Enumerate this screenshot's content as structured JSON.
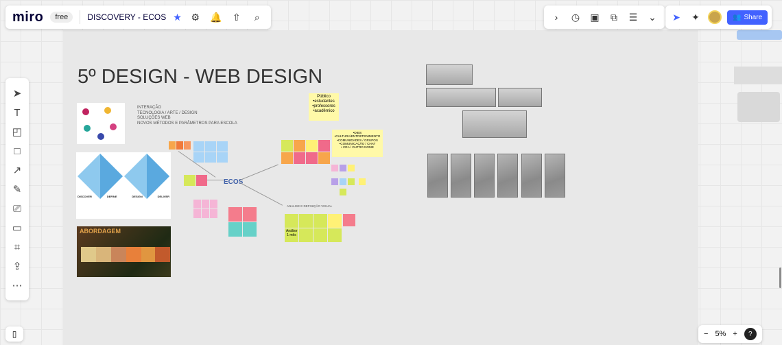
{
  "toolbar": {
    "logo": "miro",
    "plan": "free",
    "board_title": "DISCOVERY - ECOS",
    "share_label": "Share",
    "zoom": "5%"
  },
  "board": {
    "heading": "5º DESIGN - WEB DESIGN",
    "intro_lines": [
      "INTERAÇÃO",
      "TECNOLOGIA / ARTE / DESIGN",
      "SOLUÇÕES WEB",
      "NOVOS MÉTODOS E PARÂMETROS PARA ESCOLA"
    ],
    "publico_note": "Público\n•estudantes\n•professores\n•acadêmico",
    "dimensions_note": "•DIBS\n•CULTURA/ENTRETENIMENTO\n•COMUNIDADES / GRUPOS\n•COMUNICAÇÃO / CHAT\n• CRA / OUTRO NOME",
    "center_logo": "ECOS",
    "approach_label": "ABORDAGEM",
    "analyze_note": "Análise\n1 mês",
    "bottom_label": "ANALISE E DEFINIÇÃO VISUAL",
    "diamond_labels": [
      "DISCOVER",
      "DEFINE",
      "DESIGN",
      "DELIVER"
    ]
  },
  "icons": {
    "top": [
      "gear-icon",
      "bell-icon",
      "upload-icon",
      "search-icon"
    ],
    "center": [
      "chevron-right-icon",
      "timer-icon",
      "card-icon",
      "present-icon",
      "notes-icon",
      "more-icon"
    ],
    "left": [
      "select-icon",
      "text-icon",
      "sticky-note-icon",
      "shape-icon",
      "arrow-icon",
      "pen-icon",
      "comment-icon",
      "frame-icon",
      "crop-icon",
      "upload-icon",
      "more-icon"
    ]
  },
  "colors": {
    "accent": "#4262ff",
    "sticky_yellow": "#fff9a8",
    "sticky_pink": "#f5b5d6",
    "sticky_blue": "#a8d4f7",
    "sticky_green": "#d6e85a",
    "sticky_teal": "#66d1c8",
    "sticky_orange": "#f7a64b",
    "sticky_red": "#f06a6a"
  }
}
